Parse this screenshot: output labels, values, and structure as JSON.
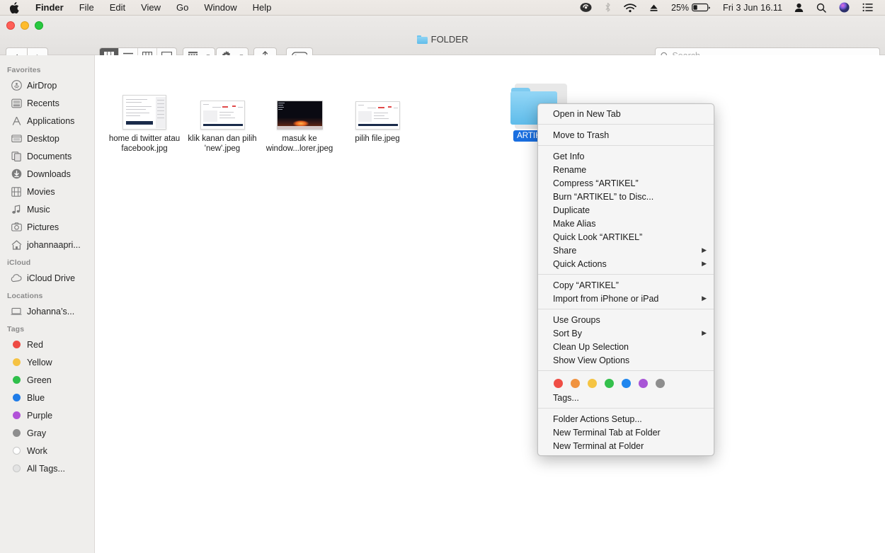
{
  "menubar": {
    "apple_icon": "apple-logo",
    "items": [
      {
        "label": "Finder",
        "bold": true
      },
      {
        "label": "File",
        "bold": false
      },
      {
        "label": "Edit",
        "bold": false
      },
      {
        "label": "View",
        "bold": false
      },
      {
        "label": "Go",
        "bold": false
      },
      {
        "label": "Window",
        "bold": false
      },
      {
        "label": "Help",
        "bold": false
      }
    ],
    "extras": {
      "creative_cloud_icon": "creative-cloud-icon",
      "bluetooth_icon": "bluetooth-icon",
      "wifi_icon": "wifi-icon",
      "eject_icon": "eject-icon",
      "battery_percent": "25%",
      "battery_icon": "battery-icon",
      "clock": "Fri 3 Jun  16.11",
      "user_icon": "user-icon",
      "search_icon": "spotlight-search-icon",
      "siri_icon": "siri-icon",
      "control_center_icon": "control-center-icon"
    }
  },
  "window": {
    "title": "FOLDER",
    "traffic_lights": [
      "close",
      "minimize",
      "zoom"
    ]
  },
  "toolbar": {
    "back_label": "‹",
    "forward_label": "›",
    "view_modes": [
      {
        "name": "icon-view",
        "active": true
      },
      {
        "name": "list-view",
        "active": false
      },
      {
        "name": "column-view",
        "active": false
      },
      {
        "name": "gallery-view",
        "active": false
      }
    ],
    "group_by_label": "group-by-button",
    "action_label": "action-gear-button",
    "share_label": "share-button",
    "tags_label": "tags-button"
  },
  "search": {
    "placeholder": "Search",
    "value": ""
  },
  "sidebar": {
    "sections": [
      {
        "header": "Favorites",
        "items": [
          {
            "label": "AirDrop",
            "icon": "airdrop-icon"
          },
          {
            "label": "Recents",
            "icon": "recents-icon"
          },
          {
            "label": "Applications",
            "icon": "applications-icon"
          },
          {
            "label": "Desktop",
            "icon": "desktop-icon"
          },
          {
            "label": "Documents",
            "icon": "documents-icon"
          },
          {
            "label": "Downloads",
            "icon": "downloads-icon"
          },
          {
            "label": "Movies",
            "icon": "movies-icon"
          },
          {
            "label": "Music",
            "icon": "music-icon"
          },
          {
            "label": "Pictures",
            "icon": "pictures-icon"
          },
          {
            "label": "johannaapri...",
            "icon": "home-icon"
          }
        ]
      },
      {
        "header": "iCloud",
        "items": [
          {
            "label": "iCloud Drive",
            "icon": "icloud-icon"
          }
        ]
      },
      {
        "header": "Locations",
        "items": [
          {
            "label": "Johanna’s...",
            "icon": "laptop-icon"
          }
        ]
      },
      {
        "header": "Tags",
        "items": [
          {
            "label": "Red",
            "icon": "tag-dot",
            "color": "#ee4b44"
          },
          {
            "label": "Yellow",
            "icon": "tag-dot",
            "color": "#f5c243"
          },
          {
            "label": "Green",
            "icon": "tag-dot",
            "color": "#2fbf4b"
          },
          {
            "label": "Blue",
            "icon": "tag-dot",
            "color": "#1f7ce8"
          },
          {
            "label": "Purple",
            "icon": "tag-dot",
            "color": "#b martin"
          },
          {
            "label": "Gray",
            "icon": "tag-dot",
            "color": "#8e8e8e"
          },
          {
            "label": "Work",
            "icon": "tag-dot-hollow",
            "color": "#ffffff"
          },
          {
            "label": "All Tags...",
            "icon": "tag-dot-alltags",
            "color": "#e3e3e3"
          }
        ]
      }
    ]
  },
  "content": {
    "files": [
      {
        "name": "home di twitter atau facebook.jpg",
        "thumb": "document-screenshot"
      },
      {
        "name": "klik kanan dan pilih 'new'.jpeg",
        "thumb": "browser-screenshot"
      },
      {
        "name": "masuk ke window...lorer.jpeg",
        "thumb": "dark-screenshot"
      },
      {
        "name": "pilih file.jpeg",
        "thumb": "browser-screenshot"
      }
    ],
    "folder": {
      "name": "ARTIKEL",
      "selected": true
    }
  },
  "context_menu": {
    "groups": [
      {
        "items": [
          {
            "label": "Open in New Tab",
            "submenu": false
          }
        ]
      },
      {
        "items": [
          {
            "label": "Move to Trash",
            "submenu": false
          }
        ]
      },
      {
        "items": [
          {
            "label": "Get Info",
            "submenu": false
          },
          {
            "label": "Rename",
            "submenu": false
          },
          {
            "label": "Compress “ARTIKEL”",
            "submenu": false
          },
          {
            "label": "Burn “ARTIKEL” to Disc...",
            "submenu": false
          },
          {
            "label": "Duplicate",
            "submenu": false
          },
          {
            "label": "Make Alias",
            "submenu": false
          },
          {
            "label": "Quick Look “ARTIKEL”",
            "submenu": false
          },
          {
            "label": "Share",
            "submenu": true
          },
          {
            "label": "Quick Actions",
            "submenu": true
          }
        ]
      },
      {
        "items": [
          {
            "label": "Copy “ARTIKEL”",
            "submenu": false
          },
          {
            "label": "Import from iPhone or iPad",
            "submenu": true
          }
        ]
      },
      {
        "items": [
          {
            "label": "Use Groups",
            "submenu": false
          },
          {
            "label": "Sort By",
            "submenu": true
          },
          {
            "label": "Clean Up Selection",
            "submenu": false
          },
          {
            "label": "Show View Options",
            "submenu": false
          }
        ]
      },
      {
        "swatches": [
          "#ef4e45",
          "#f09340",
          "#f5c443",
          "#34c04c",
          "#1f86ee",
          "#a855d6",
          "#8e8e8e"
        ],
        "items": [
          {
            "label": "Tags...",
            "submenu": false
          }
        ]
      },
      {
        "items": [
          {
            "label": "Folder Actions Setup...",
            "submenu": false
          },
          {
            "label": "New Terminal Tab at Folder",
            "submenu": false
          },
          {
            "label": "New Terminal at Folder",
            "submenu": false
          }
        ]
      }
    ]
  }
}
